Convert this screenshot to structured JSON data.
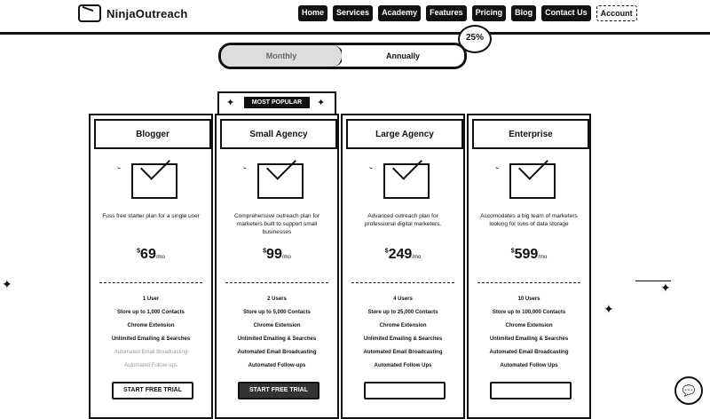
{
  "brand": {
    "name": "NinjaOutreach"
  },
  "nav": {
    "items": [
      "Home",
      "Services",
      "Academy",
      "Features",
      "Pricing",
      "Blog",
      "Contact Us",
      "Account"
    ]
  },
  "badge": {
    "text": "25%"
  },
  "billing": {
    "monthly_label": "Monthly",
    "annual_label": "Annually"
  },
  "popular": {
    "label": "MOST POPULAR"
  },
  "plans": [
    {
      "title": "Blogger",
      "desc": "Fuss free starter plan for a single user",
      "price_symbol": "$",
      "price": "69",
      "period": "/mo",
      "features": [
        "1 User",
        "Store up to 1,000 Contacts",
        "Chrome Extension",
        "Unlimited Emailing & Searches",
        "Automated Email Broadcasting",
        "Automated Follow-ups"
      ],
      "cta": "START FREE TRIAL"
    },
    {
      "title": "Small Agency",
      "desc": "Comprehensive outreach plan for marketers built to support small businesses",
      "price_symbol": "$",
      "price": "99",
      "period": "/mo",
      "features": [
        "2 Users",
        "Store up to 5,000 Contacts",
        "Chrome Extension",
        "Unlimited Emailing & Searches",
        "Automated Email Broadcasting",
        "Automated Follow-ups"
      ],
      "cta": "START FREE TRIAL"
    },
    {
      "title": "Large Agency",
      "desc": "Advanced outreach plan for professional digital marketers.",
      "price_symbol": "$",
      "price": "249",
      "period": "/mo",
      "features": [
        "4 Users",
        "Store up to 25,000 Contacts",
        "Chrome Extension",
        "Unlimited Emailing & Searches",
        "Automated Email Broadcasting",
        "Automated Follow Ups"
      ],
      "cta": ""
    },
    {
      "title": "Enterprise",
      "desc": "Accomodates a big team of marketers looking for tons of data storage",
      "price_symbol": "$",
      "price": "599",
      "period": "/mo",
      "features": [
        "10 Users",
        "Store up to 100,000 Contacts",
        "Chrome Extension",
        "Unlimited Emailing & Searches",
        "Automated Email Broadcasting",
        "Automated Follow Ups"
      ],
      "cta": ""
    }
  ],
  "icons": {
    "chat": "chat-icon",
    "spark": "sparkle-icon",
    "envelope": "ninja-envelope-icon"
  }
}
